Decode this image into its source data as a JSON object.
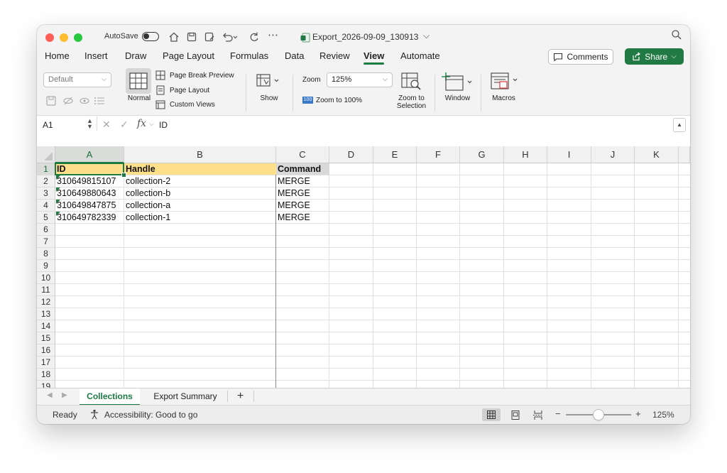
{
  "titlebar": {
    "autosave_label": "AutoSave",
    "more": "⋯",
    "file_title": "Export_2026-09-09_130913",
    "title_chevron": "⌵",
    "search_glyph": "⌕"
  },
  "tabs": [
    {
      "label": "Home"
    },
    {
      "label": "Insert"
    },
    {
      "label": "Draw"
    },
    {
      "label": "Page Layout"
    },
    {
      "label": "Formulas"
    },
    {
      "label": "Data"
    },
    {
      "label": "Review"
    },
    {
      "label": "View",
      "active": true
    },
    {
      "label": "Automate"
    }
  ],
  "header_buttons": {
    "comments": "Comments",
    "share": "Share"
  },
  "ribbon": {
    "sheet_view_value": "Default",
    "normal_label": "Normal",
    "page_break_preview": "Page Break Preview",
    "page_layout": "Page Layout",
    "custom_views": "Custom Views",
    "show_label": "Show",
    "zoom_label": "Zoom",
    "zoom_value": "125%",
    "zoom_100_badge": "100",
    "zoom_to_100": "Zoom to 100%",
    "zoom_to_selection_1": "Zoom to",
    "zoom_to_selection_2": "Selection",
    "window_label": "Window",
    "macros_label": "Macros"
  },
  "formula_bar": {
    "name_box": "A1",
    "fx": "fx",
    "content": "ID"
  },
  "grid": {
    "columns": [
      "A",
      "B",
      "C",
      "D",
      "E",
      "F",
      "G",
      "H",
      "I",
      "J",
      "K"
    ],
    "rows": [
      "1",
      "2",
      "3",
      "4",
      "5",
      "6",
      "7",
      "8",
      "9",
      "10",
      "11",
      "12",
      "13",
      "14",
      "15",
      "16",
      "17",
      "18",
      "19"
    ],
    "headers": {
      "a": "ID",
      "b": "Handle",
      "c": "Command"
    },
    "data": [
      {
        "id": "310649815107",
        "handle": "collection-2",
        "command": "MERGE"
      },
      {
        "id": "310649880643",
        "handle": "collection-b",
        "command": "MERGE"
      },
      {
        "id": "310649847875",
        "handle": "collection-a",
        "command": "MERGE"
      },
      {
        "id": "310649782339",
        "handle": "collection-1",
        "command": "MERGE"
      }
    ]
  },
  "sheets": {
    "tabs": [
      "Collections",
      "Export Summary"
    ],
    "active": "Collections",
    "add": "+"
  },
  "status": {
    "ready": "Ready",
    "accessibility": "Accessibility: Good to go",
    "zoom_minus": "−",
    "zoom_plus": "+",
    "zoom_pct": "125%",
    "zoom_level_fraction": 0.5
  },
  "colors": {
    "accent": "#1b7b43",
    "share_bg": "#217a43",
    "header_fill": "#ffe08a",
    "command_header_fill": "#d9d9d9",
    "close": "#ff5f57",
    "minimize": "#febc2e",
    "zoom": "#28c840"
  }
}
